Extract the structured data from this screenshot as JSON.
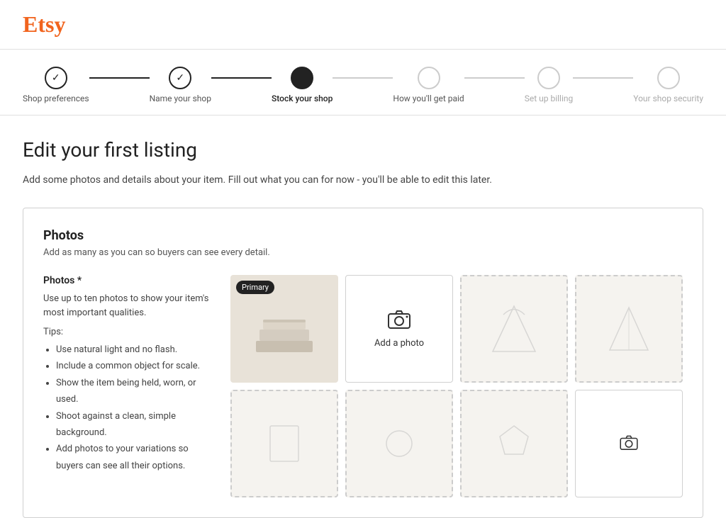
{
  "header": {
    "logo": "Etsy"
  },
  "progress": {
    "steps": [
      {
        "id": "shop-preferences",
        "label": "Shop preferences",
        "state": "completed",
        "symbol": "✓"
      },
      {
        "id": "name-your-shop",
        "label": "Name your shop",
        "state": "completed",
        "symbol": "✓"
      },
      {
        "id": "stock-your-shop",
        "label": "Stock your shop",
        "state": "active",
        "symbol": ""
      },
      {
        "id": "how-youll-get-paid",
        "label": "How you'll get paid",
        "state": "upcoming",
        "symbol": ""
      },
      {
        "id": "set-up-billing",
        "label": "Set up billing",
        "state": "inactive",
        "symbol": ""
      },
      {
        "id": "your-shop-security",
        "label": "Your shop security",
        "state": "inactive",
        "symbol": ""
      }
    ]
  },
  "page": {
    "title": "Edit your first listing",
    "subtitle": "Add some photos and details about your item. Fill out what you can for now - you'll be able to edit this later."
  },
  "photos_card": {
    "title": "Photos",
    "subtitle": "Add as many as you can so buyers can see every detail.",
    "field_label": "Photos *",
    "field_desc": "Use up to ten photos to show your item's most important qualities.",
    "tips_label": "Tips:",
    "tips": [
      "Use natural light and no flash.",
      "Include a common object for scale.",
      "Show the item being held, worn, or used.",
      "Shoot against a clean, simple background.",
      "Add photos to your variations so buyers can see all their options."
    ],
    "primary_badge": "Primary",
    "add_photo_label": "Add a photo"
  }
}
